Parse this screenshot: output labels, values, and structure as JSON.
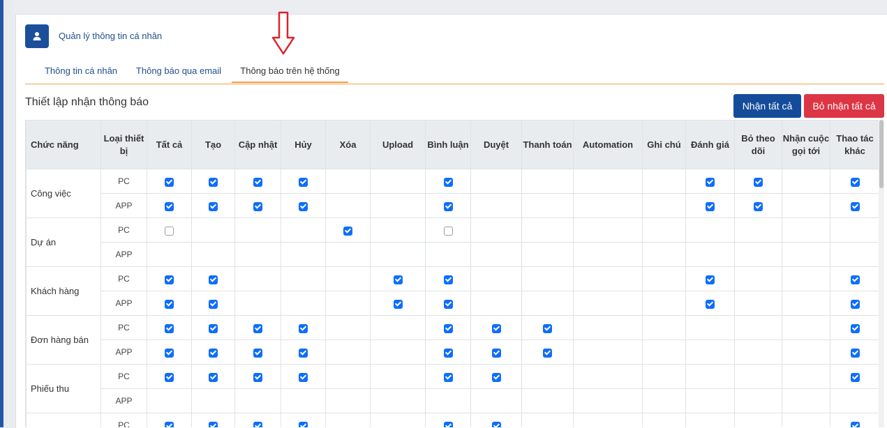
{
  "header": {
    "title": "Quản lý thông tin cá nhân",
    "icon": "user-icon"
  },
  "tabs": [
    {
      "label": "Thông tin cá nhân",
      "active": false
    },
    {
      "label": "Thông báo qua email",
      "active": false
    },
    {
      "label": "Thông báo trên hệ thống",
      "active": true
    }
  ],
  "section": {
    "title": "Thiết lập nhận thông báo"
  },
  "buttons": {
    "select_all": "Nhận tất cả",
    "deselect_all": "Bỏ nhận tất cả"
  },
  "colors": {
    "primary": "#144c9a",
    "danger": "#dc3545",
    "accent": "#f0a04b",
    "checkbox": "#0d6efd",
    "annotation_arrow": "#d9252a"
  },
  "table": {
    "columns": [
      "Chức năng",
      "Loại thiết bị",
      "Tất cả",
      "Tạo",
      "Cập nhật",
      "Hủy",
      "Xóa",
      "Upload",
      "Bình luận",
      "Duyệt",
      "Thanh toán",
      "Automation",
      "Ghi chú",
      "Đánh giá",
      "Bỏ theo dõi",
      "Nhận cuộc gọi tới",
      "Thao tác khác"
    ],
    "rows": [
      {
        "function": "Công việc",
        "devices": [
          {
            "device": "PC",
            "cells": [
              1,
              1,
              1,
              1,
              null,
              null,
              1,
              null,
              null,
              null,
              null,
              1,
              1,
              null,
              1
            ]
          },
          {
            "device": "APP",
            "cells": [
              1,
              1,
              1,
              1,
              null,
              null,
              1,
              null,
              null,
              null,
              null,
              1,
              1,
              null,
              1
            ]
          }
        ]
      },
      {
        "function": "Dự án",
        "devices": [
          {
            "device": "PC",
            "cells": [
              0,
              null,
              null,
              null,
              1,
              null,
              0,
              null,
              null,
              null,
              null,
              null,
              null,
              null,
              null
            ]
          },
          {
            "device": "APP",
            "cells": [
              null,
              null,
              null,
              null,
              null,
              null,
              null,
              null,
              null,
              null,
              null,
              null,
              null,
              null,
              null
            ]
          }
        ]
      },
      {
        "function": "Khách hàng",
        "devices": [
          {
            "device": "PC",
            "cells": [
              1,
              1,
              null,
              null,
              null,
              1,
              1,
              null,
              null,
              null,
              null,
              1,
              null,
              null,
              1
            ]
          },
          {
            "device": "APP",
            "cells": [
              1,
              1,
              null,
              null,
              null,
              1,
              1,
              null,
              null,
              null,
              null,
              1,
              null,
              null,
              1
            ]
          }
        ]
      },
      {
        "function": "Đơn hàng bán",
        "devices": [
          {
            "device": "PC",
            "cells": [
              1,
              1,
              1,
              1,
              null,
              null,
              1,
              1,
              1,
              null,
              null,
              null,
              null,
              null,
              1
            ]
          },
          {
            "device": "APP",
            "cells": [
              1,
              1,
              1,
              1,
              null,
              null,
              1,
              1,
              1,
              null,
              null,
              null,
              null,
              null,
              1
            ]
          }
        ]
      },
      {
        "function": "Phiếu thu",
        "devices": [
          {
            "device": "PC",
            "cells": [
              1,
              1,
              1,
              1,
              null,
              null,
              1,
              1,
              null,
              null,
              null,
              null,
              null,
              null,
              1
            ]
          },
          {
            "device": "APP",
            "cells": [
              null,
              null,
              null,
              null,
              null,
              null,
              null,
              null,
              null,
              null,
              null,
              null,
              null,
              null,
              null
            ]
          }
        ]
      },
      {
        "function": "",
        "devices": [
          {
            "device": "PC",
            "cells": [
              1,
              1,
              1,
              1,
              null,
              null,
              1,
              1,
              null,
              null,
              null,
              null,
              null,
              null,
              1
            ]
          }
        ]
      }
    ]
  }
}
